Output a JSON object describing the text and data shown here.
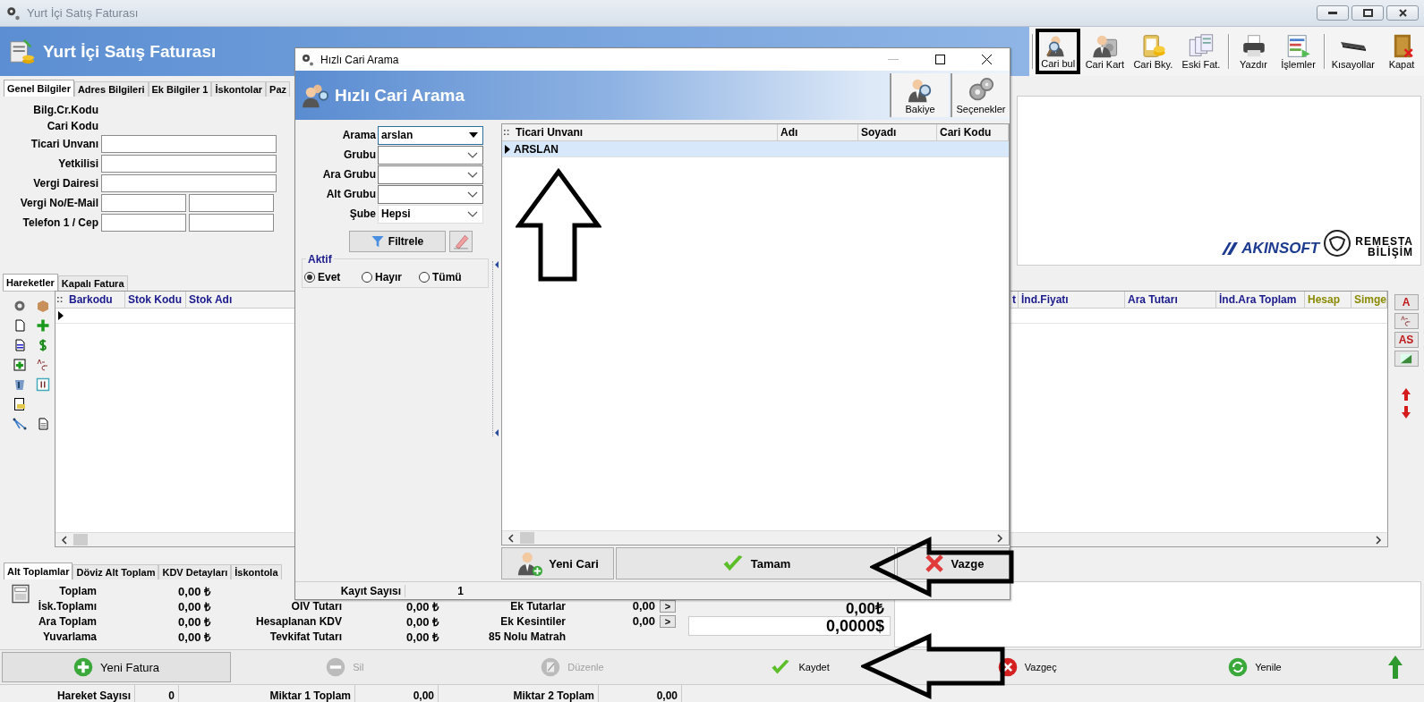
{
  "window": {
    "title": "Yurt İçi Satış Faturası"
  },
  "header": {
    "title": "Yurt İçi Satış Faturası"
  },
  "toolbar": [
    {
      "label": "Cari bul",
      "kind": "find",
      "highlighted": true,
      "separator_before": true
    },
    {
      "label": "Cari Kart",
      "kind": "card",
      "highlighted": false,
      "separator_before": false
    },
    {
      "label": "Cari Bky.",
      "kind": "balance",
      "highlighted": false,
      "separator_before": false
    },
    {
      "label": "Eski Fat.",
      "kind": "archive",
      "highlighted": false,
      "separator_before": false
    },
    {
      "label": "Yazdır",
      "kind": "print",
      "highlighted": false,
      "separator_before": true
    },
    {
      "label": "İşlemler",
      "kind": "actions",
      "highlighted": false,
      "separator_before": false
    },
    {
      "label": "Kısayollar",
      "kind": "shortcuts",
      "highlighted": false,
      "separator_before": true
    },
    {
      "label": "Kapat",
      "kind": "close",
      "highlighted": false,
      "separator_before": false
    }
  ],
  "top_tabs": [
    {
      "label": "Genel Bilgiler",
      "selected": true
    },
    {
      "label": "Adres Bilgileri",
      "selected": false
    },
    {
      "label": "Ek Bilgiler 1",
      "selected": false
    },
    {
      "label": "İskontolar",
      "selected": false
    },
    {
      "label": "Paz",
      "selected": false
    }
  ],
  "form": [
    {
      "label": "Bilg.Cr.Kodu",
      "kind": "plain"
    },
    {
      "label": "Cari Kodu",
      "kind": "plain"
    },
    {
      "label": "Ticari Unvanı",
      "kind": "wide"
    },
    {
      "label": "Yetkilisi",
      "kind": "wide"
    },
    {
      "label": "Vergi Dairesi",
      "kind": "wide"
    },
    {
      "label": "Vergi No/E-Mail",
      "kind": "pair"
    },
    {
      "label": "Telefon 1 / Cep",
      "kind": "pair"
    }
  ],
  "brand": {
    "logo": "AKINSOFT",
    "partner_line_1": "REMESTA",
    "partner_line_2": "BİLİŞİM"
  },
  "lines_tabs": [
    {
      "label": "Hareketler",
      "selected": true
    },
    {
      "label": "Kapalı Fatura",
      "selected": false
    }
  ],
  "lines_table": {
    "handle": "::",
    "columns_left": [
      {
        "label": "Barkodu",
        "color": "#1a1a8c"
      },
      {
        "label": "Stok Kodu",
        "color": "#1a1a8c"
      },
      {
        "label": "Stok Adı",
        "color": "#1a1a8c"
      }
    ],
    "columns_right": [
      {
        "label": "t",
        "color": "#1a1a8c"
      },
      {
        "label": "İnd.Fiyatı",
        "color": "#1a1a8c"
      },
      {
        "label": "Ara Tutarı",
        "color": "#1a1a8c"
      },
      {
        "label": "İnd.Ara Toplam",
        "color": "#1a1a8c"
      },
      {
        "label": "Hesap",
        "color": "#8a8a00"
      },
      {
        "label": "Simge",
        "color": "#8a8a00"
      }
    ]
  },
  "side_tools": [
    {
      "label": "A",
      "kind": "letter"
    },
    {
      "kind": "text-style"
    },
    {
      "label": "AS",
      "kind": "letter"
    },
    {
      "kind": "image"
    }
  ],
  "totals_tabs": [
    {
      "label": "Alt Toplamlar",
      "selected": true
    },
    {
      "label": "Döviz Alt Toplam",
      "selected": false
    },
    {
      "label": "KDV Detayları",
      "selected": false
    },
    {
      "label": "İskontola",
      "selected": false
    }
  ],
  "totals": {
    "column_1": [
      {
        "label": "Toplam",
        "value": "0,00 ₺"
      },
      {
        "label": "İsk.Toplamı",
        "value": "0,00 ₺"
      },
      {
        "label": "Ara Toplam",
        "value": "0,00 ₺"
      },
      {
        "label": "Yuvarlama",
        "value": "0,00 ₺"
      }
    ],
    "column_2": [
      {
        "label": "OIV Tutarı",
        "value": "0,00 ₺"
      },
      {
        "label": "Hesaplanan KDV",
        "value": "0,00 ₺"
      },
      {
        "label": "Tevkifat Tutarı",
        "value": "0,00 ₺"
      }
    ],
    "column_3": [
      {
        "label": "Ek Tutarlar",
        "value": "0,00",
        "button": ">"
      },
      {
        "label": "Ek Kesintiler",
        "value": "0,00",
        "button": ">"
      },
      {
        "label": "85 Nolu Matrah"
      }
    ],
    "big_values": [
      "0,00₺",
      "0,0000$"
    ]
  },
  "actions": [
    {
      "label": "Yeni Fatura",
      "kind": "new",
      "disabled": false
    },
    {
      "label": "Sil",
      "kind": "delete",
      "disabled": true
    },
    {
      "label": "Düzenle",
      "kind": "edit",
      "disabled": true
    },
    {
      "label": "Kaydet",
      "kind": "save",
      "disabled": false
    },
    {
      "label": "Vazgeç",
      "kind": "cancel",
      "disabled": false
    },
    {
      "label": "Yenile",
      "kind": "refresh",
      "disabled": false
    }
  ],
  "status_bar": [
    {
      "label": "Hareket Sayısı",
      "value": "0"
    },
    {
      "label": "Miktar 1 Toplam",
      "value": "0,00"
    },
    {
      "label": "Miktar 2 Toplam",
      "value": "0,00"
    }
  ],
  "dialog": {
    "title": "Hızlı Cari Arama",
    "header": "Hızlı Cari Arama",
    "header_buttons": [
      {
        "label": "Bakiye",
        "kind": "balance"
      },
      {
        "label": "Seçenekler",
        "kind": "options"
      }
    ],
    "fields": [
      {
        "label": "Arama",
        "value": "arslan",
        "kind": "combo",
        "disabled": false
      },
      {
        "label": "Grubu",
        "kind": "select",
        "disabled": false
      },
      {
        "label": "Ara Grubu",
        "kind": "select",
        "disabled": false
      },
      {
        "label": "Alt Grubu",
        "kind": "select",
        "disabled": false
      },
      {
        "label": "Şube",
        "value": "Hepsi",
        "kind": "select",
        "disabled": true
      }
    ],
    "filter_button": "Filtrele",
    "active_group": {
      "title": "Aktif",
      "options": [
        {
          "label": "Evet",
          "selected": true
        },
        {
          "label": "Hayır",
          "selected": false
        },
        {
          "label": "Tümü",
          "selected": false
        }
      ]
    },
    "table": {
      "handle": "::",
      "columns": [
        "Ticari Unvanı",
        "Adı",
        "Soyadı",
        "Cari Kodu"
      ],
      "rows": [
        {
          "cells": [
            "ARSLAN"
          ],
          "selected": true
        }
      ]
    },
    "buttons": [
      {
        "label": "Yeni Cari",
        "kind": "new"
      },
      {
        "label": "Tamam",
        "kind": "ok"
      },
      {
        "label": "Vazge",
        "kind": "cancel"
      }
    ],
    "status": {
      "label": "Kayıt Sayısı",
      "value": "1"
    }
  }
}
